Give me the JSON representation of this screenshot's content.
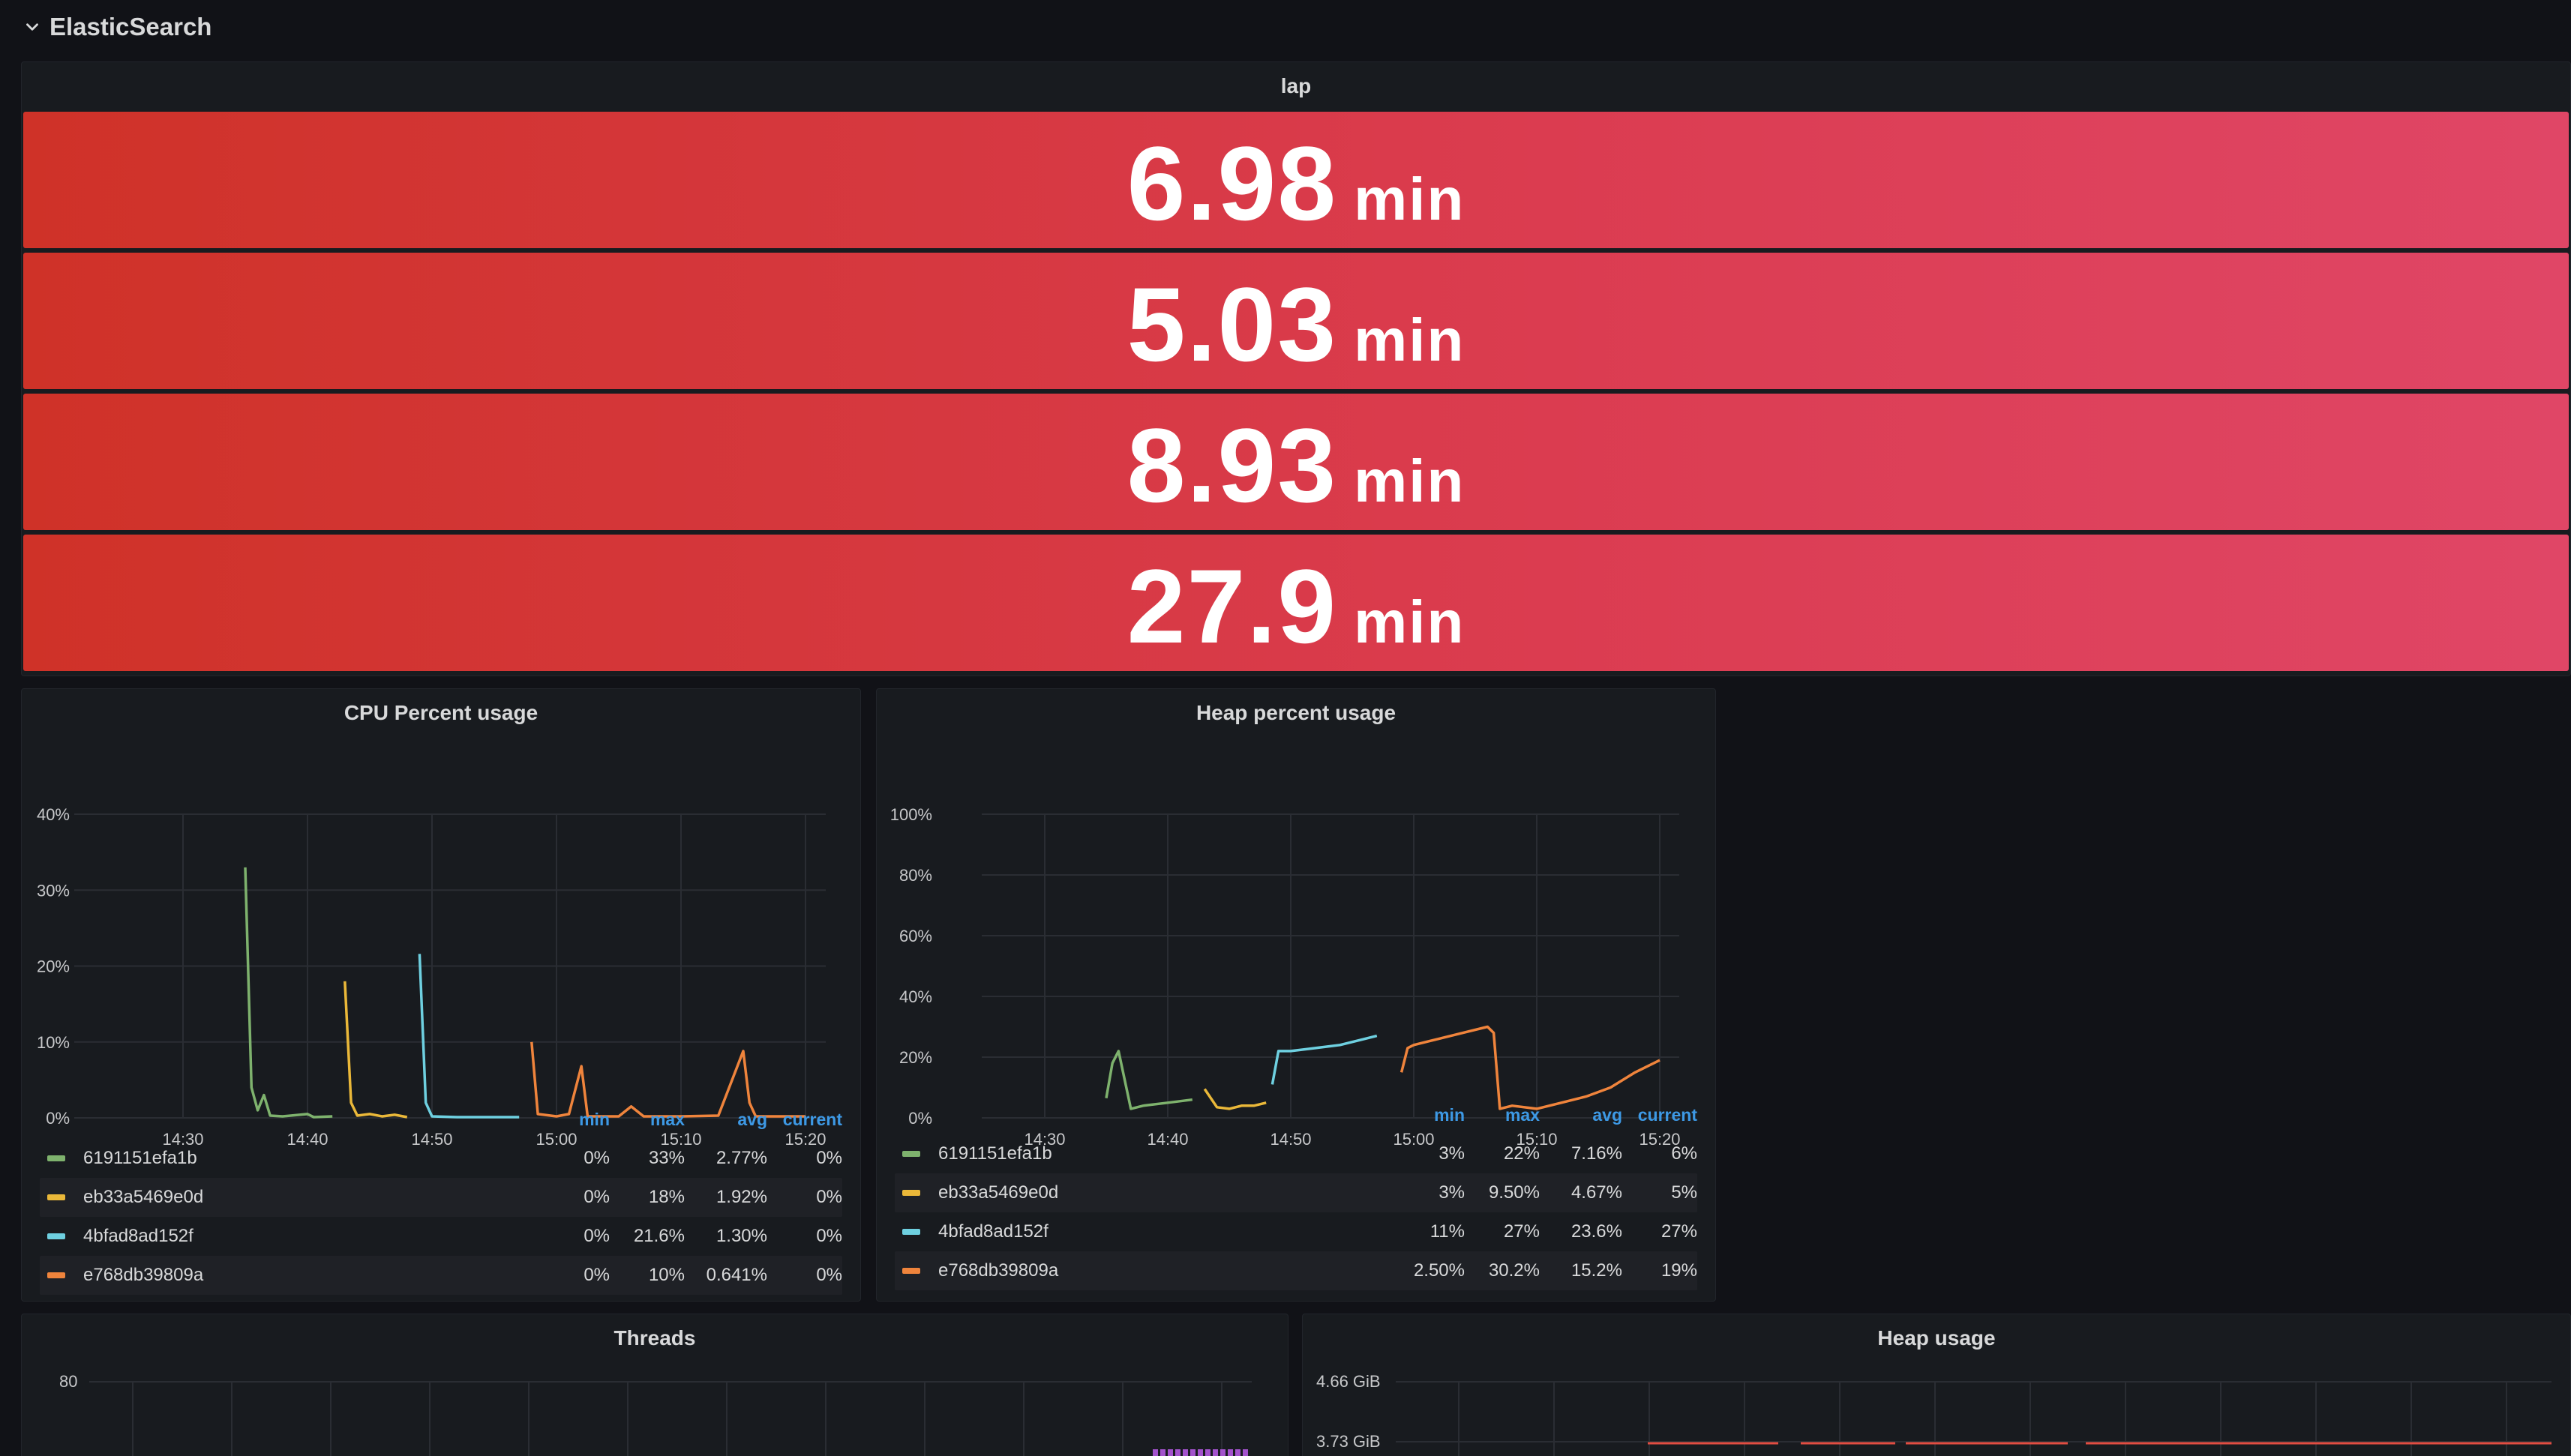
{
  "row": {
    "title": "ElasticSearch"
  },
  "lap": {
    "title": "lap",
    "unit": "min",
    "values": [
      "6.98",
      "5.03",
      "8.93",
      "27.9"
    ]
  },
  "cpu": {
    "title": "CPU Percent usage",
    "y_ticks": [
      "40%",
      "30%",
      "20%",
      "10%",
      "0%"
    ],
    "x_ticks": [
      "14:30",
      "14:40",
      "14:50",
      "15:00",
      "15:10",
      "15:20"
    ],
    "legend_headers": {
      "min": "min",
      "max": "max",
      "avg": "avg",
      "current": "current"
    },
    "series": [
      {
        "name": "6191151efa1b",
        "color": "#7eb26d",
        "min": "0%",
        "max": "33%",
        "avg": "2.77%",
        "current": "0%"
      },
      {
        "name": "eb33a5469e0d",
        "color": "#eab839",
        "min": "0%",
        "max": "18%",
        "avg": "1.92%",
        "current": "0%"
      },
      {
        "name": "4bfad8ad152f",
        "color": "#6ed0e0",
        "min": "0%",
        "max": "21.6%",
        "avg": "1.30%",
        "current": "0%"
      },
      {
        "name": "e768db39809a",
        "color": "#ef843c",
        "min": "0%",
        "max": "10%",
        "avg": "0.641%",
        "current": "0%"
      }
    ]
  },
  "heap_pct": {
    "title": "Heap percent usage",
    "y_ticks": [
      "100%",
      "80%",
      "60%",
      "40%",
      "20%",
      "0%"
    ],
    "x_ticks": [
      "14:30",
      "14:40",
      "14:50",
      "15:00",
      "15:10",
      "15:20"
    ],
    "legend_headers": {
      "min": "min",
      "max": "max",
      "avg": "avg",
      "current": "current"
    },
    "series": [
      {
        "name": "6191151efa1b",
        "color": "#7eb26d",
        "min": "3%",
        "max": "22%",
        "avg": "7.16%",
        "current": "6%"
      },
      {
        "name": "eb33a5469e0d",
        "color": "#eab839",
        "min": "3%",
        "max": "9.50%",
        "avg": "4.67%",
        "current": "5%"
      },
      {
        "name": "4bfad8ad152f",
        "color": "#6ed0e0",
        "min": "11%",
        "max": "27%",
        "avg": "23.6%",
        "current": "27%"
      },
      {
        "name": "e768db39809a",
        "color": "#ef843c",
        "min": "2.50%",
        "max": "30.2%",
        "avg": "15.2%",
        "current": "19%"
      }
    ]
  },
  "threads": {
    "title": "Threads",
    "y_tick": "80"
  },
  "heap_usage": {
    "title": "Heap usage",
    "y_ticks": [
      "4.66 GiB",
      "3.73 GiB"
    ]
  },
  "chart_data": [
    {
      "type": "line",
      "title": "CPU Percent usage",
      "ylim": [
        0,
        40
      ],
      "x_ticks": [
        "14:30",
        "14:40",
        "14:50",
        "15:00",
        "15:10",
        "15:20"
      ],
      "series": [
        {
          "name": "6191151efa1b",
          "x": [
            "14:35",
            "14:35.5",
            "14:36",
            "14:36.5",
            "14:37",
            "14:38",
            "14:40",
            "14:40.5",
            "14:42"
          ],
          "y": [
            33,
            4,
            1,
            3,
            0.3,
            0.2,
            0.5,
            0.1,
            0.2
          ]
        },
        {
          "name": "eb33a5469e0d",
          "x": [
            "14:43",
            "14:43.5",
            "14:44",
            "14:45",
            "14:46",
            "14:47",
            "14:48"
          ],
          "y": [
            18,
            2,
            0.3,
            0.5,
            0.2,
            0.4,
            0.1
          ]
        },
        {
          "name": "4bfad8ad152f",
          "x": [
            "14:49",
            "14:49.5",
            "14:50",
            "14:52",
            "14:54",
            "14:57"
          ],
          "y": [
            21.6,
            2,
            0.2,
            0.1,
            0.1,
            0.1
          ]
        },
        {
          "name": "e768db39809a",
          "x": [
            "14:58",
            "14:58.5",
            "15:00",
            "15:01",
            "15:02",
            "15:02.5",
            "15:05",
            "15:06",
            "15:07",
            "15:10",
            "15:13",
            "15:15",
            "15:15.5",
            "15:16",
            "15:20"
          ],
          "y": [
            10,
            0.5,
            0.2,
            0.5,
            6.8,
            0.2,
            0.2,
            1.5,
            0.2,
            0.2,
            0.3,
            8.8,
            2,
            0.2,
            0.2
          ]
        }
      ]
    },
    {
      "type": "line",
      "title": "Heap percent usage",
      "ylim": [
        0,
        100
      ],
      "x_ticks": [
        "14:30",
        "14:40",
        "14:50",
        "15:00",
        "15:10",
        "15:20"
      ],
      "series": [
        {
          "name": "6191151efa1b",
          "x": [
            "14:35",
            "14:35.5",
            "14:36",
            "14:37",
            "14:38",
            "14:40",
            "14:42"
          ],
          "y": [
            6.5,
            18,
            22,
            3,
            4,
            5,
            6
          ]
        },
        {
          "name": "eb33a5469e0d",
          "x": [
            "14:43",
            "14:44",
            "14:45",
            "14:46",
            "14:47",
            "14:48"
          ],
          "y": [
            9.5,
            3.5,
            3,
            4,
            4,
            5
          ]
        },
        {
          "name": "4bfad8ad152f",
          "x": [
            "14:48.5",
            "14:49",
            "14:50",
            "14:52",
            "14:54",
            "14:56",
            "14:57"
          ],
          "y": [
            11,
            22,
            22,
            23,
            24,
            26,
            27
          ]
        },
        {
          "name": "e768db39809a",
          "x": [
            "14:59",
            "14:59.5",
            "15:00",
            "15:02",
            "15:04",
            "15:06",
            "15:06.5",
            "15:07",
            "15:08",
            "15:10",
            "15:12",
            "15:14",
            "15:16",
            "15:18",
            "15:20"
          ],
          "y": [
            15,
            23,
            24,
            26,
            28,
            30,
            28,
            3,
            4,
            3,
            5,
            7,
            10,
            15,
            19
          ]
        }
      ]
    }
  ]
}
